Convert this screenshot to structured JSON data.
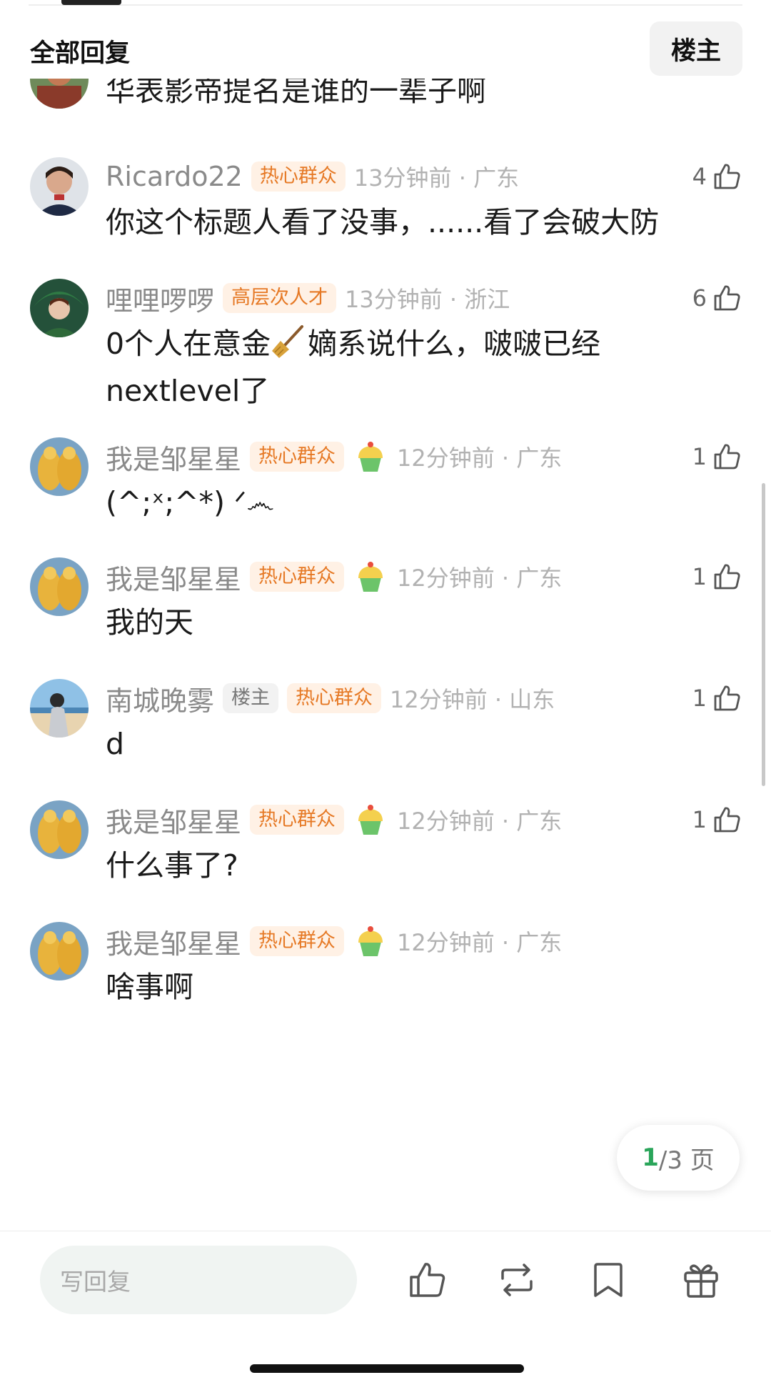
{
  "header": {
    "title": "全部回复",
    "op_filter": "楼主"
  },
  "comments": [
    {
      "username": "",
      "text": "华表影帝提名是谁的一辈子啊",
      "badges": [],
      "time": "",
      "location": "",
      "likes": ""
    },
    {
      "username": "Ricardo22",
      "badges": [
        "热心群众"
      ],
      "time": "13分钟前",
      "location": "广东",
      "likes": "4",
      "text": "你这个标题人看了没事，......看了会破大防"
    },
    {
      "username": "哩哩啰啰",
      "badges": [
        "高层次人才"
      ],
      "time": "13分钟前",
      "location": "浙江",
      "likes": "6",
      "text_before": "0个人在意金",
      "text_after": "嫡系说什么，啵啵已经nextlevel了",
      "emoji": "broom"
    },
    {
      "username": "我是邹星星",
      "badges": [
        "热心群众"
      ],
      "time": "12分钟前",
      "location": "广东",
      "likes": "1",
      "text": "(^;ˣ;^*) ᐟ෴"
    },
    {
      "username": "我是邹星星",
      "badges": [
        "热心群众"
      ],
      "time": "12分钟前",
      "location": "广东",
      "likes": "1",
      "text": "我的天"
    },
    {
      "username": "南城晚雾",
      "badges": [
        "楼主",
        "热心群众"
      ],
      "time": "12分钟前",
      "location": "山东",
      "likes": "1",
      "text": "d"
    },
    {
      "username": "我是邹星星",
      "badges": [
        "热心群众"
      ],
      "time": "12分钟前",
      "location": "广东",
      "likes": "1",
      "text": "什么事了?"
    },
    {
      "username": "我是邹星星",
      "badges": [
        "热心群众"
      ],
      "time": "12分钟前",
      "location": "广东",
      "likes": "",
      "text": "啥事啊"
    }
  ],
  "pager": {
    "current": "1",
    "total_text": "/3 页"
  },
  "bottom_bar": {
    "reply_placeholder": "写回复"
  },
  "colors": {
    "badge_orange": "#e67925",
    "badge_bg": "#fff1e5",
    "accent_green": "#2aa55a"
  },
  "icons": [
    "thumbs-up-icon",
    "repost-icon",
    "bookmark-icon",
    "gift-icon",
    "cupcake-icon",
    "broom-icon"
  ]
}
